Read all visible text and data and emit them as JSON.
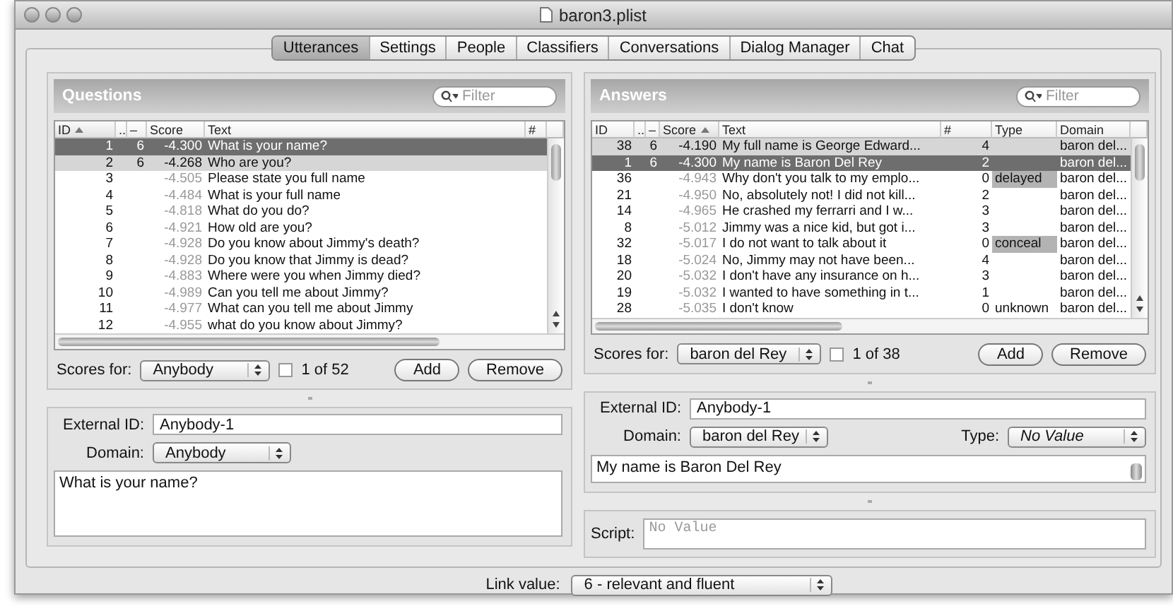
{
  "window": {
    "title": "baron3.plist"
  },
  "tabs": [
    {
      "label": "Utterances",
      "selected": true
    },
    {
      "label": "Settings",
      "selected": false
    },
    {
      "label": "People",
      "selected": false
    },
    {
      "label": "Classifiers",
      "selected": false
    },
    {
      "label": "Conversations",
      "selected": false
    },
    {
      "label": "Dialog Manager",
      "selected": false
    },
    {
      "label": "Chat",
      "selected": false
    }
  ],
  "questions": {
    "title": "Questions",
    "filter": {
      "placeholder": "Filter"
    },
    "columns": [
      {
        "label": "ID",
        "sorted": true
      },
      {
        "label": "..",
        "sorted": false
      },
      {
        "label": "–",
        "sorted": false
      },
      {
        "label": "Score",
        "sorted": false
      },
      {
        "label": "Text",
        "sorted": false
      },
      {
        "label": "#",
        "sorted": false
      }
    ],
    "rows": [
      {
        "id": "1",
        "link": "6",
        "score": "-4.300",
        "text": "What is your name?",
        "selected": true,
        "highlighted": false
      },
      {
        "id": "2",
        "link": "6",
        "score": "-4.268",
        "text": "Who are you?",
        "selected": false,
        "highlighted": true
      },
      {
        "id": "3",
        "score": "-4.505",
        "text": "Please state you full name",
        "selected": false,
        "highlighted": false
      },
      {
        "id": "4",
        "score": "-4.484",
        "text": "What is your full name",
        "selected": false,
        "highlighted": false
      },
      {
        "id": "5",
        "score": "-4.818",
        "text": "What do you do?",
        "selected": false,
        "highlighted": false
      },
      {
        "id": "6",
        "score": "-4.921",
        "text": "How old are you?",
        "selected": false,
        "highlighted": false
      },
      {
        "id": "7",
        "score": "-4.928",
        "text": "Do you know about Jimmy's death?",
        "selected": false,
        "highlighted": false
      },
      {
        "id": "8",
        "score": "-4.928",
        "text": "Do you know that Jimmy is dead?",
        "selected": false,
        "highlighted": false
      },
      {
        "id": "9",
        "score": "-4.883",
        "text": "Where were you when Jimmy died?",
        "selected": false,
        "highlighted": false
      },
      {
        "id": "10",
        "score": "-4.989",
        "text": "Can you tell me about Jimmy?",
        "selected": false,
        "highlighted": false
      },
      {
        "id": "11",
        "score": "-4.977",
        "text": "What can you tell me about Jimmy",
        "selected": false,
        "highlighted": false
      },
      {
        "id": "12",
        "score": "-4.955",
        "text": "what do you know about Jimmy?",
        "selected": false,
        "highlighted": false
      }
    ],
    "scores_for": {
      "label": "Scores for:",
      "value": "Anybody"
    },
    "checkbox": {
      "label": "1 of 52",
      "checked": false
    },
    "buttons": [
      "Add",
      "Remove"
    ],
    "editor": {
      "external_id_label": "External ID:",
      "external_id": "Anybody-1",
      "domain_label": "Domain:",
      "domain": "Anybody",
      "text": "What is your name?"
    }
  },
  "answers": {
    "title": "Answers",
    "filter": {
      "placeholder": "Filter"
    },
    "columns": [
      {
        "label": "ID",
        "sorted": false
      },
      {
        "label": "..",
        "sorted": false
      },
      {
        "label": "–",
        "sorted": false
      },
      {
        "label": "Score",
        "sorted": true
      },
      {
        "label": "Text",
        "sorted": false
      },
      {
        "label": "#",
        "sorted": false
      },
      {
        "label": "Type",
        "sorted": false
      },
      {
        "label": "Domain",
        "sorted": false
      }
    ],
    "rows": [
      {
        "id": "38",
        "link": "6",
        "score": "-4.190",
        "text": "My full name is George Edward...",
        "count": "4",
        "domain": "baron del...",
        "type_shaded": false,
        "selected": false,
        "highlighted": true
      },
      {
        "id": "1",
        "link": "6",
        "score": "-4.300",
        "text": "My name is Baron Del Rey",
        "count": "2",
        "domain": "baron del...",
        "type_shaded": false,
        "selected": true,
        "highlighted": false
      },
      {
        "id": "36",
        "score": "-4.943",
        "text": "Why don't you talk to my emplo...",
        "count": "0",
        "type": "delayed",
        "domain": "baron del...",
        "type_shaded": true,
        "selected": false,
        "highlighted": false
      },
      {
        "id": "21",
        "score": "-4.950",
        "text": "No, absolutely not! I did not kill...",
        "count": "2",
        "domain": "baron del...",
        "type_shaded": false,
        "selected": false,
        "highlighted": false
      },
      {
        "id": "14",
        "score": "-4.965",
        "text": "He crashed my ferrarri and I w...",
        "count": "3",
        "domain": "baron del...",
        "type_shaded": false,
        "selected": false,
        "highlighted": false
      },
      {
        "id": "8",
        "score": "-5.012",
        "text": "Jimmy was a nice kid, but got i...",
        "count": "3",
        "domain": "baron del...",
        "type_shaded": false,
        "selected": false,
        "highlighted": false
      },
      {
        "id": "32",
        "score": "-5.017",
        "text": "I do not want to talk about it",
        "count": "0",
        "type": "conceal",
        "domain": "baron del...",
        "type_shaded": true,
        "selected": false,
        "highlighted": false
      },
      {
        "id": "18",
        "score": "-5.024",
        "text": "No, Jimmy may not have been...",
        "count": "4",
        "domain": "baron del...",
        "type_shaded": false,
        "selected": false,
        "highlighted": false
      },
      {
        "id": "20",
        "score": "-5.032",
        "text": "I don't have any insurance on h...",
        "count": "3",
        "domain": "baron del...",
        "type_shaded": false,
        "selected": false,
        "highlighted": false
      },
      {
        "id": "19",
        "score": "-5.032",
        "text": "I wanted to have something in t...",
        "count": "1",
        "domain": "baron del...",
        "type_shaded": false,
        "selected": false,
        "highlighted": false
      },
      {
        "id": "28",
        "score": "-5.035",
        "text": "I don't know",
        "count": "0",
        "type": "unknown",
        "domain": "baron del...",
        "type_shaded": false,
        "selected": false,
        "highlighted": false
      }
    ],
    "scores_for": {
      "label": "Scores for:",
      "value": "baron del Rey"
    },
    "checkbox": {
      "label": "1 of 38",
      "checked": false
    },
    "buttons": [
      "Add",
      "Remove"
    ],
    "editor": {
      "external_id_label": "External ID:",
      "external_id": "Anybody-1",
      "domain_label": "Domain:",
      "domain": "baron del Rey",
      "type_label": "Type:",
      "type": "No Value",
      "text": "My name is Baron Del Rey",
      "script_label": "Script:",
      "script_placeholder": "No Value"
    }
  },
  "link_value": {
    "label": "Link value:",
    "value": "6 - relevant and fluent"
  }
}
